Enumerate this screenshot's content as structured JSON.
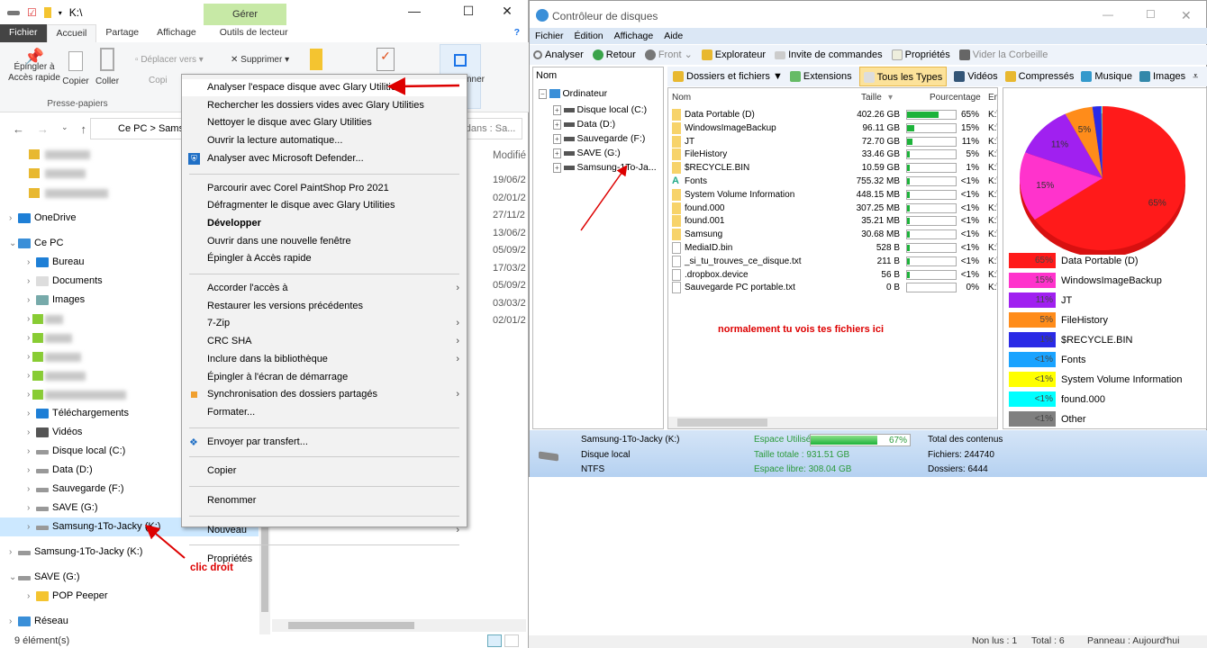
{
  "explorer": {
    "path": "K:\\",
    "manage_tab": "Gérer",
    "tabs": [
      "Fichier",
      "Accueil",
      "Partage",
      "Affichage",
      "Outils de lecteur"
    ],
    "ribbon": {
      "pin": "Épingler à Accès rapide",
      "copy": "Copier",
      "paste": "Coller",
      "clipboard_group": "Presse-papiers",
      "move_to": "Déplacer vers",
      "delete": "Supprimer",
      "copy_to": "Copi",
      "select": "nner"
    },
    "breadcrumb": [
      "Ce PC",
      "Sams"
    ],
    "search_placeholder": "r dans : Sa...",
    "column_modified": "Modifié",
    "dates": [
      "19/06/2",
      "02/01/2",
      "27/11/2",
      "13/06/2",
      "05/09/2",
      "17/03/2",
      "05/09/2",
      "03/03/2",
      "02/01/2"
    ],
    "tree": [
      {
        "label": "OneDrive",
        "icon": "cloud"
      },
      {
        "label": "Ce PC",
        "icon": "computer"
      },
      {
        "label": "Bureau",
        "icon": "desktop"
      },
      {
        "label": "Documents",
        "icon": "documents"
      },
      {
        "label": "Images",
        "icon": "pictures"
      },
      {
        "label": "Téléchargements",
        "icon": "download"
      },
      {
        "label": "Vidéos",
        "icon": "videos"
      },
      {
        "label": "Disque local (C:)",
        "icon": "drive"
      },
      {
        "label": "Data (D:)",
        "icon": "drive"
      },
      {
        "label": "Sauvegarde (F:)",
        "icon": "drive"
      },
      {
        "label": "SAVE (G:)",
        "icon": "drive"
      },
      {
        "label": "Samsung-1To-Jacky (K:)",
        "icon": "drive",
        "selected": true
      },
      {
        "label": "Samsung-1To-Jacky (K:)",
        "icon": "drive"
      },
      {
        "label": "SAVE (G:)",
        "icon": "drive"
      },
      {
        "label": "POP Peeper",
        "icon": "folder"
      },
      {
        "label": "Réseau",
        "icon": "network"
      }
    ],
    "status": "9 élément(s)"
  },
  "context_menu": {
    "items": [
      {
        "label": "Analyser l'espace disque avec Glary Utilities",
        "highlight": true
      },
      {
        "label": "Rechercher les dossiers vides avec Glary Utilities"
      },
      {
        "label": "Nettoyer le disque avec Glary Utilities"
      },
      {
        "label": "Ouvrir la lecture automatique..."
      },
      {
        "label": "Analyser avec Microsoft Defender...",
        "icon": "shield"
      },
      {
        "sep": true
      },
      {
        "label": "Parcourir avec Corel PaintShop Pro 2021"
      },
      {
        "label": "Défragmenter le disque avec Glary Utilities"
      },
      {
        "label": "Développer",
        "bold": true
      },
      {
        "label": "Ouvrir dans une nouvelle fenêtre"
      },
      {
        "label": "Épingler à Accès rapide"
      },
      {
        "sep": true
      },
      {
        "label": "Accorder l'accès à",
        "submenu": true
      },
      {
        "label": "Restaurer les versions précédentes"
      },
      {
        "label": "7-Zip",
        "submenu": true
      },
      {
        "label": "CRC SHA",
        "submenu": true
      },
      {
        "label": "Inclure dans la bibliothèque",
        "submenu": true
      },
      {
        "label": "Épingler à l'écran de démarrage"
      },
      {
        "label": "Synchronisation des dossiers partagés",
        "submenu": true,
        "icon": "sync"
      },
      {
        "label": "Formater..."
      },
      {
        "sep": true
      },
      {
        "label": "Envoyer par transfert...",
        "icon": "dropbox"
      },
      {
        "sep": true
      },
      {
        "label": "Copier"
      },
      {
        "sep": true
      },
      {
        "label": "Renommer"
      },
      {
        "sep": true
      },
      {
        "label": "Nouveau",
        "submenu": true
      },
      {
        "sep": true
      },
      {
        "label": "Propriétés"
      }
    ]
  },
  "disk_app": {
    "title": "Contrôleur de disques",
    "menu": [
      "Fichier",
      "Édition",
      "Affichage",
      "Aide"
    ],
    "toolbar": [
      "Analyser",
      "Retour",
      "Front",
      "Explorateur",
      "Invite de commandes",
      "Propriétés",
      "Vider la Corbeille"
    ],
    "tree_header": "Nom",
    "tree": [
      "Ordinateur",
      "Disque local (C:)",
      "Data (D:)",
      "Sauvegarde (F:)",
      "SAVE (G:)",
      "Samsung-1To-Ja..."
    ],
    "filter_tabs": [
      "Dossiers et fichiers ▼",
      "Extensions",
      "Tous les Types",
      "Vidéos",
      "Compressés",
      "Musique",
      "Images"
    ],
    "columns": [
      "Nom",
      "Taille",
      "Pourcentage",
      "Em"
    ],
    "files": [
      {
        "name": "Data Portable (D)",
        "size": "402.26 GB",
        "pct": "65%",
        "p": 65,
        "type": "folder",
        "loc": "K:\\"
      },
      {
        "name": "WindowsImageBackup",
        "size": "96.11 GB",
        "pct": "15%",
        "p": 15,
        "type": "folder",
        "loc": "K:\\"
      },
      {
        "name": "JT",
        "size": "72.70 GB",
        "pct": "11%",
        "p": 11,
        "type": "folder",
        "loc": "K:\\"
      },
      {
        "name": "FileHistory",
        "size": "33.46 GB",
        "pct": "5%",
        "p": 5,
        "type": "folder",
        "loc": "K:\\"
      },
      {
        "name": "$RECYCLE.BIN",
        "size": "10.59 GB",
        "pct": "1%",
        "p": 1,
        "type": "folder",
        "loc": "K:\\"
      },
      {
        "name": "Fonts",
        "size": "755.32 MB",
        "pct": "<1%",
        "p": 0.5,
        "type": "font",
        "loc": "K:\\"
      },
      {
        "name": "System Volume Information",
        "size": "448.15 MB",
        "pct": "<1%",
        "p": 0.5,
        "type": "folder",
        "loc": "K:\\"
      },
      {
        "name": "found.000",
        "size": "307.25 MB",
        "pct": "<1%",
        "p": 0.5,
        "type": "folder",
        "loc": "K:\\"
      },
      {
        "name": "found.001",
        "size": "35.21 MB",
        "pct": "<1%",
        "p": 0.5,
        "type": "folder",
        "loc": "K:\\"
      },
      {
        "name": "Samsung",
        "size": "30.68 MB",
        "pct": "<1%",
        "p": 0.5,
        "type": "folder",
        "loc": "K:\\"
      },
      {
        "name": "MediaID.bin",
        "size": "528 B",
        "pct": "<1%",
        "p": 0.5,
        "type": "file",
        "loc": "K:\\"
      },
      {
        "name": "_si_tu_trouves_ce_disque.txt",
        "size": "211 B",
        "pct": "<1%",
        "p": 0.5,
        "type": "text",
        "loc": "K:\\"
      },
      {
        "name": ".dropbox.device",
        "size": "56 B",
        "pct": "<1%",
        "p": 0.5,
        "type": "file",
        "loc": "K:\\"
      },
      {
        "name": "Sauvegarde PC portable.txt",
        "size": "0 B",
        "pct": "0%",
        "p": 0,
        "type": "text",
        "loc": "K:\\"
      }
    ],
    "info": {
      "drive": "Samsung-1To-Jacky (K:)",
      "type": "Disque local",
      "fs": "NTFS",
      "used_label": "Espace Utilisé",
      "used_pct": "67%",
      "used": 67,
      "total": "Taille totale : 931.51 GB",
      "free": "Espace libre: 308.04 GB",
      "contents": "Total des contenus",
      "files": "Fichiers: 244740",
      "folders": "Dossiers: 6444"
    }
  },
  "chart_data": {
    "type": "pie",
    "slices": [
      {
        "label": "Data Portable (D)",
        "display": "65%",
        "value": 402.26,
        "color": "#ff1a1a"
      },
      {
        "label": "WindowsImageBackup",
        "display": "15%",
        "value": 96.11,
        "color": "#ff33cc"
      },
      {
        "label": "JT",
        "display": "11%",
        "value": 72.7,
        "color": "#a020f0"
      },
      {
        "label": "FileHistory",
        "display": "5%",
        "value": 33.46,
        "color": "#ff8c1a"
      },
      {
        "label": "$RECYCLE.BIN",
        "display": "1%",
        "value": 10.59,
        "color": "#2a2ae6"
      },
      {
        "label": "Fonts",
        "display": "<1%",
        "value": 0.755,
        "color": "#1aa3ff"
      },
      {
        "label": "System Volume Information",
        "display": "<1%",
        "value": 0.448,
        "color": "#ffff00"
      },
      {
        "label": "found.000",
        "display": "<1%",
        "value": 0.307,
        "color": "#00ffff"
      },
      {
        "label": "Other",
        "display": "<1%",
        "value": 0.066,
        "color": "#808080"
      }
    ],
    "legend": "below"
  },
  "annotations": {
    "right_click": "clic droit",
    "note": "normalement tu vois tes fichiers ici"
  },
  "bottom_status": {
    "unread": "Non lus : 1",
    "total": "Total : 6",
    "panel": "Panneau : Aujourd'hui"
  }
}
